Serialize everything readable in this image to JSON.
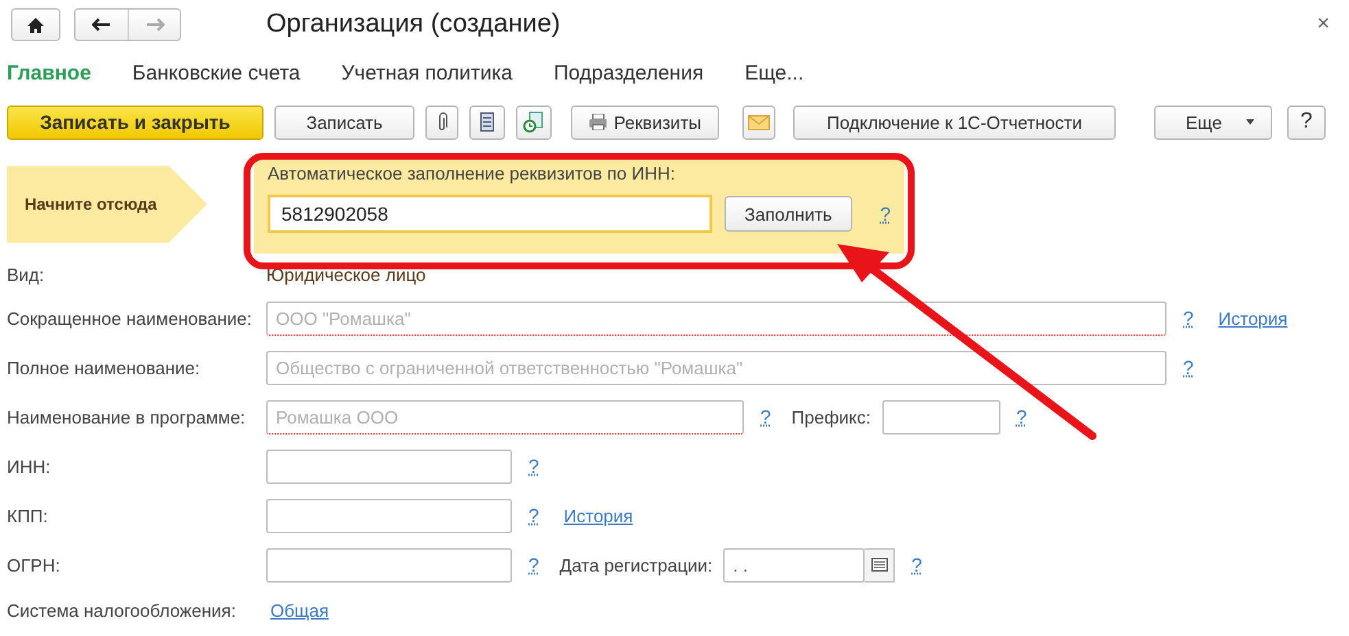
{
  "window": {
    "title": "Организация (создание)",
    "close": "×"
  },
  "tabs": [
    {
      "label": "Главное",
      "selected": true
    },
    {
      "label": "Банковские счета",
      "selected": false
    },
    {
      "label": "Учетная политика",
      "selected": false
    },
    {
      "label": "Подразделения",
      "selected": false
    },
    {
      "label": "Еще...",
      "selected": false
    }
  ],
  "toolbar": {
    "primary": "Записать и закрыть",
    "save": "Записать",
    "details": "Реквизиты",
    "connect": "Подключение к 1С-Отчетности",
    "more": "Еще",
    "help": "?"
  },
  "hint": {
    "arrow_label": "Начните отсюда",
    "title": "Автоматическое заполнение реквизитов по ИНН:",
    "inn_value": "5812902058",
    "fill_button": "Заполнить",
    "help": "?"
  },
  "kind_row": {
    "label": "Вид:",
    "value": "Юридическое лицо"
  },
  "rows": [
    {
      "label": "Сокращенное наименование:",
      "field": {
        "kind": "long",
        "placeholder": "ООО \"Ромашка\"",
        "required": true
      },
      "help": "?",
      "link": "История"
    },
    {
      "label": "Полное наименование:",
      "field": {
        "kind": "long",
        "placeholder": "Общество с ограниченной ответственностью \"Ромашка\"",
        "required": false
      },
      "help": "?"
    },
    {
      "label": "Наименование в программе:",
      "field": {
        "kind": "mid",
        "placeholder": "Ромашка ООО",
        "required": true
      },
      "help": "?",
      "extra": {
        "label": "Префикс:",
        "field": {
          "kind": "small",
          "required": false
        },
        "help": "?"
      }
    },
    {
      "label": "ИНН:",
      "field": {
        "kind": "short",
        "required": false
      },
      "help": "?"
    },
    {
      "label": "КПП:",
      "field": {
        "kind": "short",
        "required": false
      },
      "help": "?",
      "link": "История"
    },
    {
      "label": "ОГРН:",
      "field": {
        "kind": "short",
        "required": false
      },
      "help": "?",
      "extra": {
        "label": "Дата регистрации:",
        "field": {
          "kind": "date",
          "value": ". .",
          "required": false
        },
        "help": "?"
      }
    },
    {
      "label": "Система налогообложения:",
      "link": "Общая"
    }
  ]
}
